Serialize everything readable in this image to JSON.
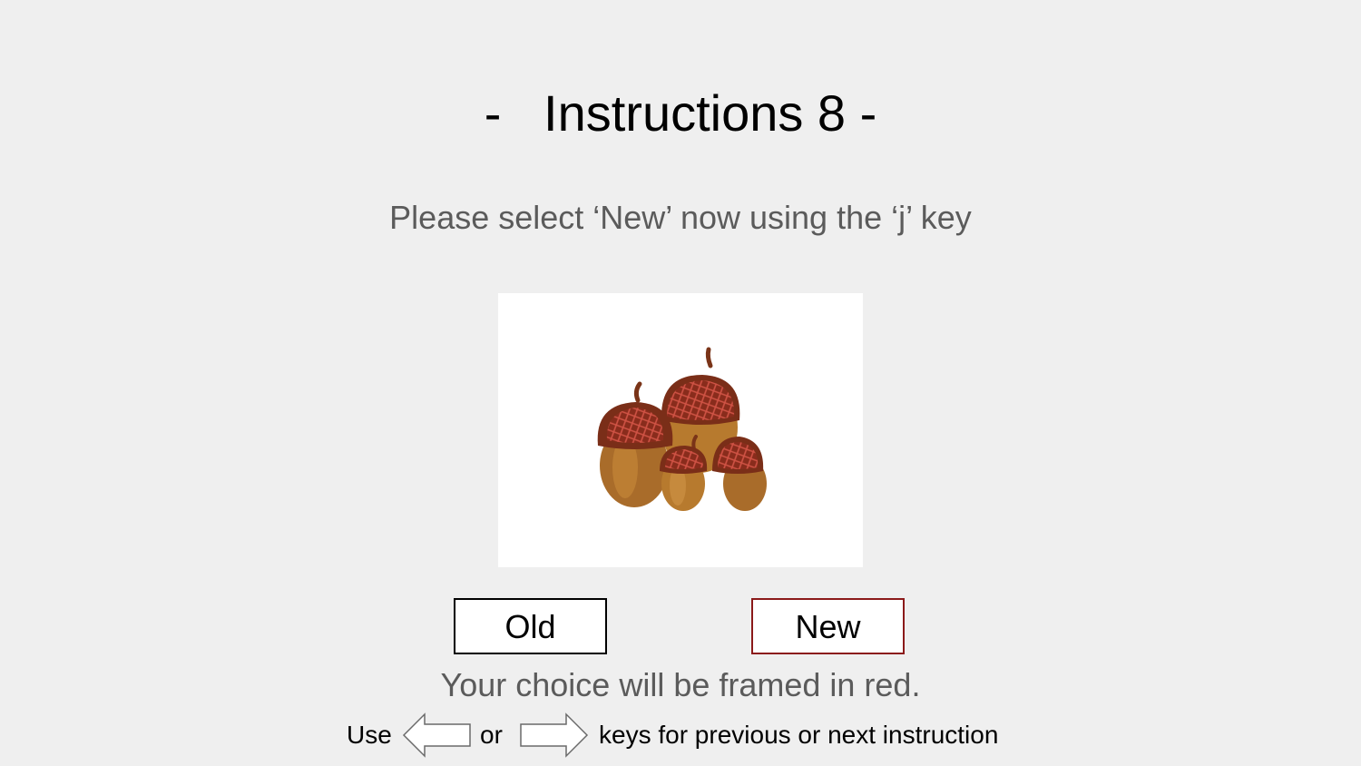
{
  "page": {
    "title": "-   Instructions 8 -",
    "instruction": "Please select ‘New’ now using the ‘j’ key",
    "stimulus_icon": "acorns-image",
    "choices": {
      "old_label": "Old",
      "new_label": "New",
      "selected": "New",
      "selected_frame_color": "#8b1a1a",
      "default_frame_color": "#000000"
    },
    "feedback": "Your choice will be framed in red.",
    "navigation": {
      "use_label": "Use",
      "left_arrow_icon": "left-arrow-icon",
      "or_label": "or",
      "right_arrow_icon": "right-arrow-icon",
      "keys_label": "keys for previous or next instruction"
    },
    "colors": {
      "background": "#efefef",
      "text_primary": "#000000",
      "text_secondary": "#5b5b5b"
    }
  }
}
